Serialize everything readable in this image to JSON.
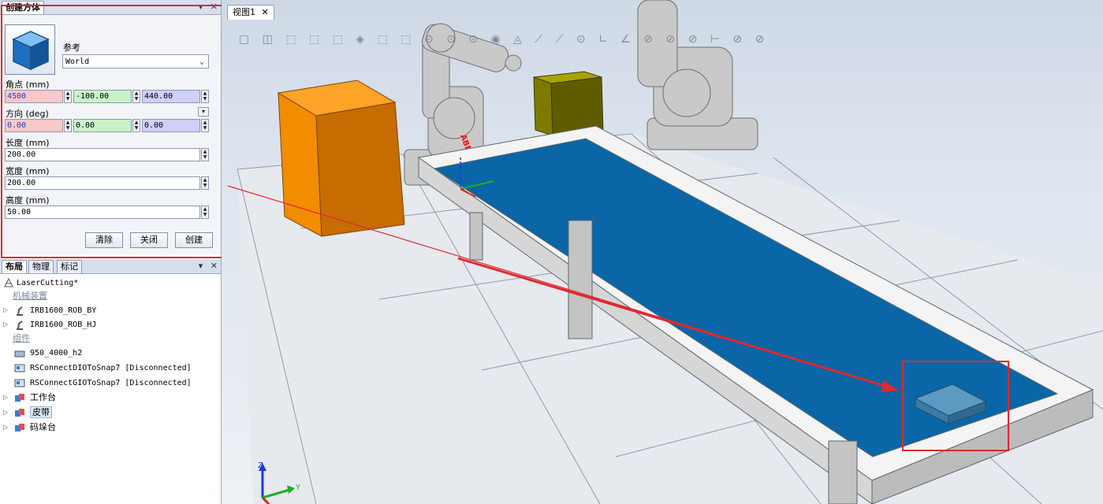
{
  "create_panel": {
    "title": "创建方体",
    "reference_label": "参考",
    "reference_value": "World",
    "corner_label": "角点 (mm)",
    "corner_x": "4500",
    "corner_y": "-100.00",
    "corner_z": "440.00",
    "orientation_label": "方向 (deg)",
    "orient_x": "0.00",
    "orient_y": "0.00",
    "orient_z": "0.00",
    "length_label": "长度 (mm)",
    "length_value": "200.00",
    "width_label": "宽度 (mm)",
    "width_value": "200.00",
    "height_label": "高度 (mm)",
    "height_value": "50.00",
    "clear_button": "清除",
    "close_button": "关闭",
    "create_button": "创建",
    "pin": "▾",
    "close": "✕"
  },
  "layout_panel": {
    "tabs": [
      "布局",
      "物理",
      "标记"
    ],
    "pin": "▾",
    "close": "✕",
    "station": "LaserCutting*",
    "mech_header": "机械装置",
    "robots": [
      "IRB1600_ROB_BY",
      "IRB1600_ROB_HJ"
    ],
    "comp_header": "组件",
    "components": [
      "950_4000_h2",
      "RSConnectDIOToSnap7 [Disconnected]",
      "RSConnectGIOToSnap7 [Disconnected]",
      "工作台",
      "皮带",
      "码垛台"
    ]
  },
  "view": {
    "tab_label": "视图1",
    "tab_close": "✕",
    "axis_z": "Z",
    "axis_y": "Y",
    "robot_brand": "ABB",
    "toolbar_glyphs": "▢ ◫ ⬚ ⬚ ⬚ ◈ ⬚ ⬚ ⊙ ⊙ ⊙ ◉ ◬ ⟋ ⟋ ⊙ ∟ ∠ ⊘ ⊘ ⊘ ⊢ ⊘ ⊘"
  },
  "colors": {
    "annotation_red": "#e0282e",
    "belt_blue": "#0a66a6",
    "orange_box": "#f28c00",
    "olive_box": "#7e7a00"
  }
}
